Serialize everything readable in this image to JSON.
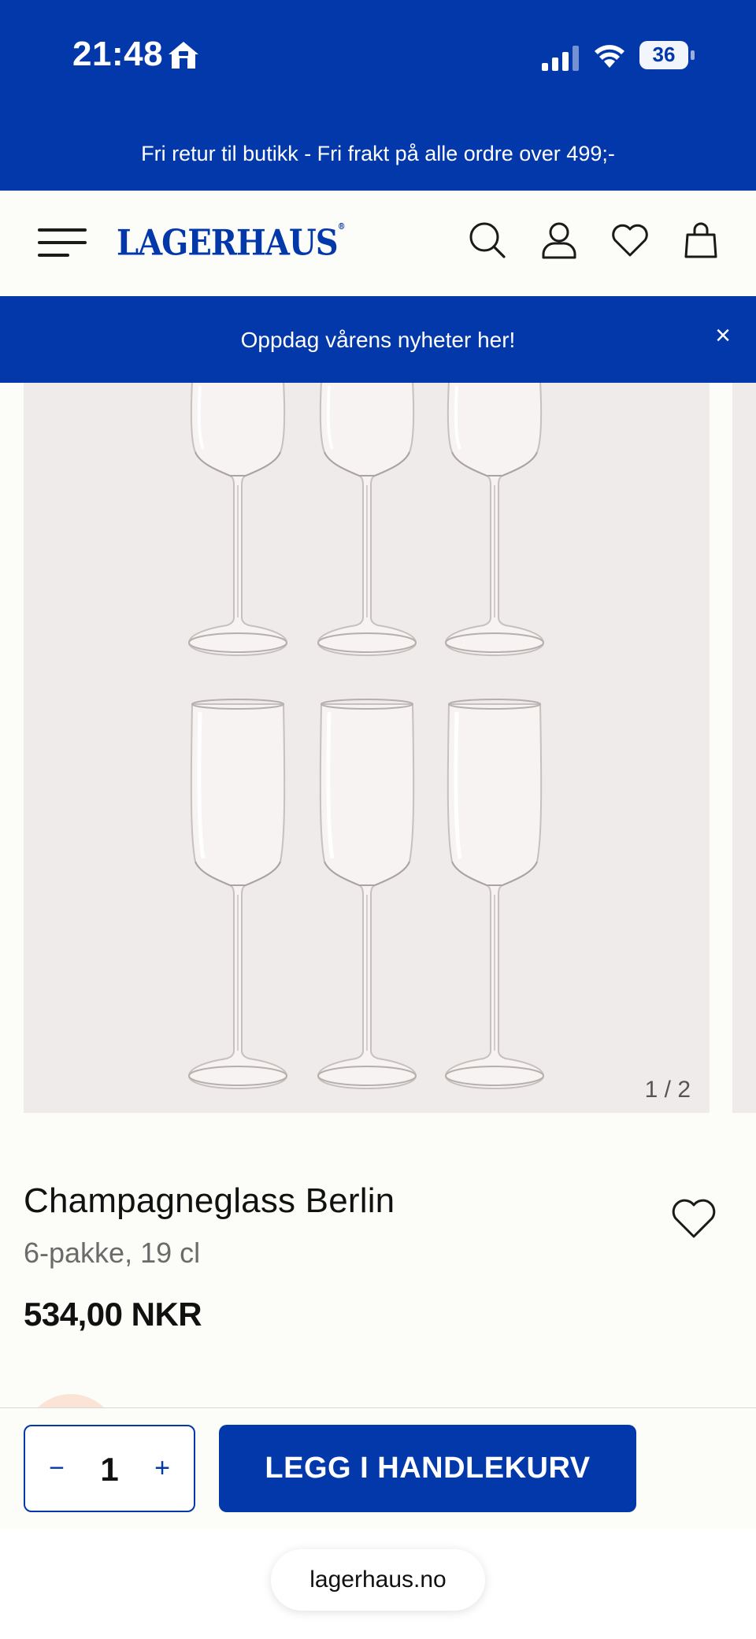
{
  "status_bar": {
    "time": "21:48",
    "battery": "36",
    "icons": [
      "home-icon",
      "signal-icon",
      "wifi-icon",
      "battery-icon"
    ]
  },
  "promo_banner": {
    "text": "Fri retur til butikk - Fri frakt på alle ordre over 499;-"
  },
  "header": {
    "logo": "LAGERHAUS",
    "logo_mark": "®",
    "icons": [
      "menu-icon",
      "search-icon",
      "account-icon",
      "heart-icon",
      "bag-icon"
    ]
  },
  "announcement": {
    "text": "Oppdag vårens nyheter her!",
    "close": "×"
  },
  "gallery": {
    "counter": "1 / 2"
  },
  "product": {
    "title": "Champagneglass Berlin",
    "subtitle": "6-pakke, 19 cl",
    "price": "534,00 NKR"
  },
  "cart_bar": {
    "minus": "−",
    "quantity": "1",
    "plus": "+",
    "add_label": "LEGG I HANDLEKURV"
  },
  "browser": {
    "url": "lagerhaus.no"
  },
  "colors": {
    "brand_blue": "#0338ab",
    "page_bg": "#fcfcf8",
    "image_bg": "#efebea"
  }
}
